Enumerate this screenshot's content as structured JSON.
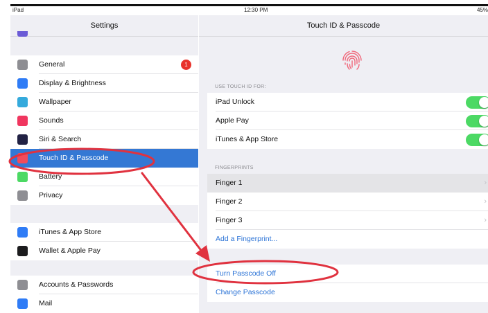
{
  "status_bar": {
    "device": "iPad",
    "time": "12:30 PM",
    "battery": "45%"
  },
  "sidebar": {
    "title": "Settings",
    "groups": [
      [
        {
          "label": "General",
          "icon": "gear-icon",
          "color": "#8e8e93",
          "badge": "1"
        },
        {
          "label": "Display & Brightness",
          "icon": "brightness-icon",
          "color": "#2f7cf6"
        },
        {
          "label": "Wallpaper",
          "icon": "wallpaper-icon",
          "color": "#35aadc"
        },
        {
          "label": "Sounds",
          "icon": "speaker-icon",
          "color": "#f0365f"
        },
        {
          "label": "Siri & Search",
          "icon": "siri-icon",
          "color": "#222244"
        },
        {
          "label": "Touch ID & Passcode",
          "icon": "fingerprint-icon",
          "color": "#f24b5b",
          "active": true
        },
        {
          "label": "Battery",
          "icon": "battery-icon",
          "color": "#4cd964"
        },
        {
          "label": "Privacy",
          "icon": "hand-icon",
          "color": "#8e8e93"
        }
      ],
      [
        {
          "label": "iTunes & App Store",
          "icon": "app-store-icon",
          "color": "#2f7cf6"
        },
        {
          "label": "Wallet & Apple Pay",
          "icon": "wallet-icon",
          "color": "#1c1c1e"
        }
      ],
      [
        {
          "label": "Accounts & Passwords",
          "icon": "key-icon",
          "color": "#8e8e93"
        },
        {
          "label": "Mail",
          "icon": "mail-icon",
          "color": "#2f7cf6"
        }
      ]
    ]
  },
  "detail": {
    "title": "Touch ID & Passcode",
    "use_touch_id_header": "USE TOUCH ID FOR:",
    "touch_id_items": [
      {
        "label": "iPad Unlock",
        "on": true
      },
      {
        "label": "Apple Pay",
        "on": true
      },
      {
        "label": "iTunes & App Store",
        "on": true
      }
    ],
    "fingerprints_header": "FINGERPRINTS",
    "fingerprints": [
      {
        "label": "Finger 1"
      },
      {
        "label": "Finger 2"
      },
      {
        "label": "Finger 3"
      }
    ],
    "add_fingerprint": "Add a Fingerprint...",
    "turn_passcode_off": "Turn Passcode Off",
    "change_passcode": "Change Passcode"
  },
  "annotation": {
    "color": "#e0323f"
  }
}
